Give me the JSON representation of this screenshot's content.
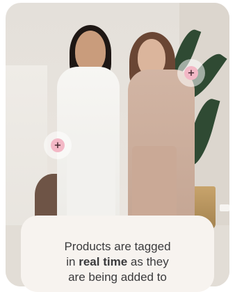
{
  "hotspots": [
    {
      "icon": "plus-icon",
      "glyph": "+"
    },
    {
      "icon": "plus-icon",
      "glyph": "+"
    }
  ],
  "caption": {
    "line1": "Products are tagged",
    "line2_prefix": "in ",
    "line2_bold": "real time",
    "line2_suffix": " as they",
    "line3": "are being added to"
  },
  "colors": {
    "hotspot_accent": "#f3b8c6",
    "panel_background": "#f7f3ef",
    "caption_text": "#3a3a3c"
  }
}
